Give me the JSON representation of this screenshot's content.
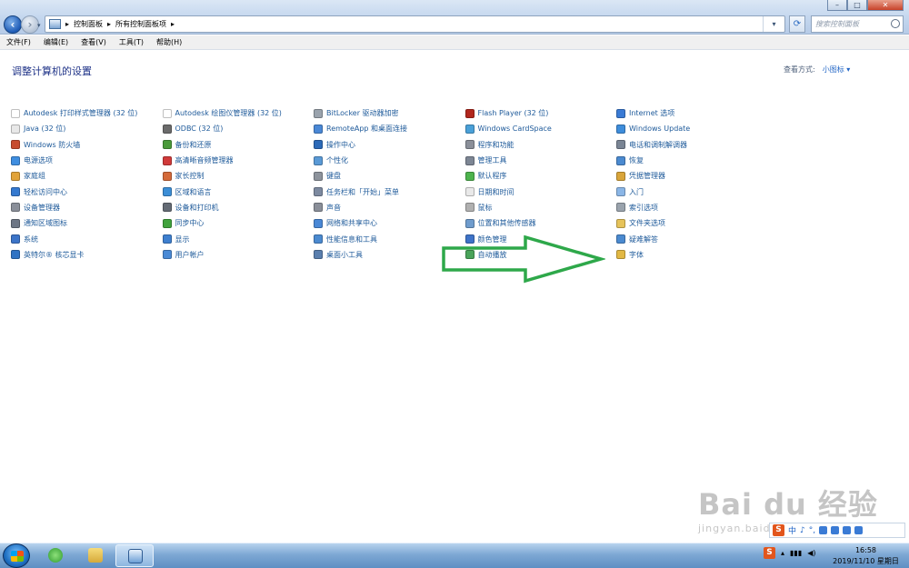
{
  "address": {
    "crumbs": [
      "控制面板",
      "所有控制面板项"
    ],
    "sep": "▸"
  },
  "search": {
    "placeholder": "搜索控制面板"
  },
  "menu": [
    "文件(F)",
    "编辑(E)",
    "查看(V)",
    "工具(T)",
    "帮助(H)"
  ],
  "page": {
    "title": "调整计算机的设置",
    "view_label": "查看方式:",
    "view_value": "小图标 ▾"
  },
  "items": [
    {
      "label": "Autodesk 打印样式管理器 (32 位)",
      "color": "#ffffff"
    },
    {
      "label": "Autodesk 绘图仪管理器 (32 位)",
      "color": "#ffffff"
    },
    {
      "label": "BitLocker 驱动器加密",
      "color": "#9aa3ad"
    },
    {
      "label": "Flash Player (32 位)",
      "color": "#b1271d"
    },
    {
      "label": "Internet 选项",
      "color": "#3a7bd5"
    },
    {
      "label": "Java (32 位)",
      "color": "#e8e8e8"
    },
    {
      "label": "ODBC (32 位)",
      "color": "#6b6b6b"
    },
    {
      "label": "RemoteApp 和桌面连接",
      "color": "#4a88d6"
    },
    {
      "label": "Windows CardSpace",
      "color": "#4aa0d8"
    },
    {
      "label": "Windows Update",
      "color": "#3e8ddb"
    },
    {
      "label": "Windows 防火墙",
      "color": "#c74b2e"
    },
    {
      "label": "备份和还原",
      "color": "#4a9a3a"
    },
    {
      "label": "操作中心",
      "color": "#2c6ab8"
    },
    {
      "label": "程序和功能",
      "color": "#8a8f99"
    },
    {
      "label": "电话和调制解调器",
      "color": "#7a8594"
    },
    {
      "label": "电源选项",
      "color": "#3f8ee0"
    },
    {
      "label": "高清晰音频管理器",
      "color": "#d13a3a"
    },
    {
      "label": "个性化",
      "color": "#5a9ad6"
    },
    {
      "label": "管理工具",
      "color": "#7d8694"
    },
    {
      "label": "恢复",
      "color": "#4b8ad0"
    },
    {
      "label": "家庭组",
      "color": "#e1a33a"
    },
    {
      "label": "家长控制",
      "color": "#d46a3a"
    },
    {
      "label": "键盘",
      "color": "#8d939c"
    },
    {
      "label": "默认程序",
      "color": "#4db34d"
    },
    {
      "label": "凭据管理器",
      "color": "#d9a53a"
    },
    {
      "label": "轻松访问中心",
      "color": "#3479cf"
    },
    {
      "label": "区域和语言",
      "color": "#3c8ed6"
    },
    {
      "label": "任务栏和「开始」菜单",
      "color": "#7d8aa0"
    },
    {
      "label": "日期和时间",
      "color": "#e9e9e9"
    },
    {
      "label": "入门",
      "color": "#8bb6e6"
    },
    {
      "label": "设备管理器",
      "color": "#8a8f99"
    },
    {
      "label": "设备和打印机",
      "color": "#646b75"
    },
    {
      "label": "声音",
      "color": "#8a8f99"
    },
    {
      "label": "鼠标",
      "color": "#b0b0b0"
    },
    {
      "label": "索引选项",
      "color": "#9aa3ad"
    },
    {
      "label": "通知区域图标",
      "color": "#6d7685"
    },
    {
      "label": "同步中心",
      "color": "#41a33d"
    },
    {
      "label": "网络和共享中心",
      "color": "#4a88d6"
    },
    {
      "label": "位置和其他传感器",
      "color": "#6f9ccd"
    },
    {
      "label": "文件夹选项",
      "color": "#e6c35a"
    },
    {
      "label": "系统",
      "color": "#3c74c8"
    },
    {
      "label": "显示",
      "color": "#3e7fcf"
    },
    {
      "label": "性能信息和工具",
      "color": "#4b8ad0"
    },
    {
      "label": "颜色管理",
      "color": "#3e73c8"
    },
    {
      "label": "疑难解答",
      "color": "#4b8ad0"
    },
    {
      "label": "英特尔® 核芯显卡",
      "color": "#2f73c4"
    },
    {
      "label": "用户帐户",
      "color": "#4a8ad6"
    },
    {
      "label": "桌面小工具",
      "color": "#5a7fae"
    },
    {
      "label": "自动播放",
      "color": "#4aa35a"
    },
    {
      "label": "字体",
      "color": "#e2b844"
    }
  ],
  "annotation": {
    "arrow_color": "#2ea84a"
  },
  "ime": {
    "badge": "S",
    "mode": "中",
    "symbols": [
      "♪",
      "°,",
      "🎤",
      "⌨",
      "👕",
      "👕"
    ]
  },
  "taskbar": {
    "time": "16:58",
    "date": "2019/11/10 星期日",
    "tray_badge": "S"
  },
  "watermark": {
    "brand": "Bai du 经验",
    "url": "jingyan.baidu.com"
  }
}
